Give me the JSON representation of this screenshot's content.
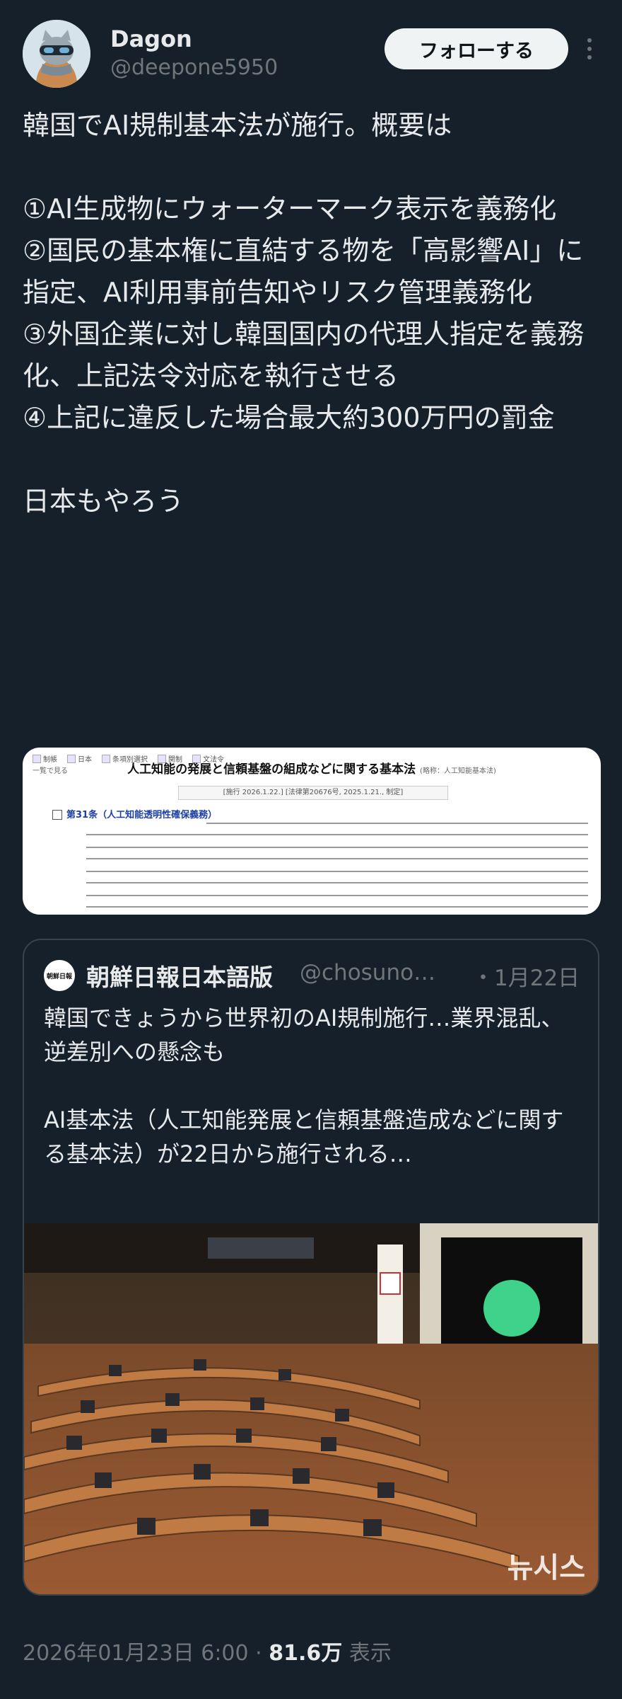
{
  "author": {
    "display_name": "Dagon",
    "handle": "@deepone5950",
    "avatar_icon": "cat-avatar-icon"
  },
  "follow_button": {
    "label": "フォローする"
  },
  "more_menu": {
    "icon": "more-vertical-icon"
  },
  "post": {
    "text": "韓国でAI規制基本法が施行。概要は\n\n①AI生成物にウォーターマーク表示を義務化\n②国民の基本権に直結する物を「高影響AI」に指定、AI利用事前告知やリスク管理義務化\n③外国企業に対し韓国国内の代理人指定を義務化、上記法令対応を執行させる\n④上記に違反した場合最大約300万円の罰金\n\n日本もやろう"
  },
  "attachment": {
    "tabs": [
      "制帳",
      "日本",
      "条項別選択",
      "関制",
      "文法令"
    ],
    "back": "一覧で見る",
    "law_title": "人工知能の発展と信頼基盤の組成などに関する基本法",
    "law_title_note": "(略称：人工知能基本法)",
    "law_meta": "[施行 2026.1.22.] [法律第20676号, 2025.1.21., 制定]",
    "article_title": "第31条（人工知能透明性確保義務）"
  },
  "quote": {
    "name": "朝鮮日報日本語版",
    "handle": "@chosuno…",
    "date": "・1月22日",
    "avatar_text": "朝鮮日報",
    "text": "韓国できょうから世界初のAI規制施行…業界混乱、逆差別への懸念も\n\nAI基本法（人工知能発展と信頼基盤造成などに関する基本法）が22日から施行される…",
    "photo_watermark": "뉴시스"
  },
  "footer": {
    "timestamp": "2026年01月23日 6:00",
    "separator": "·",
    "views": "81.6万",
    "views_label": "表示"
  },
  "colors": {
    "background": "#15202b",
    "text": "#e7e9ea",
    "muted": "#71767b",
    "border": "#38444d"
  }
}
